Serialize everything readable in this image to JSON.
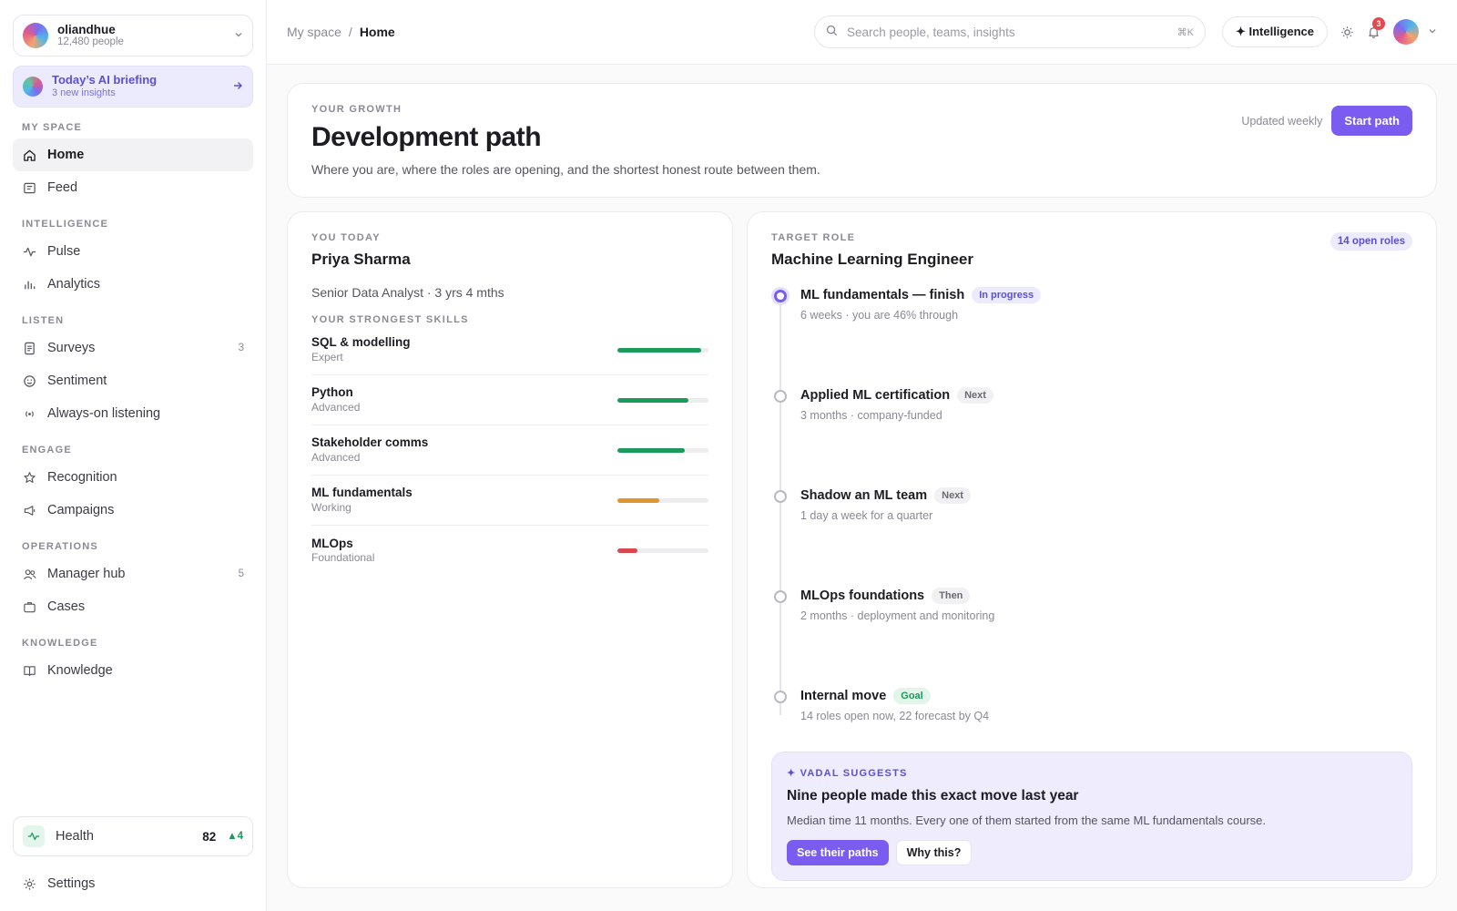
{
  "org": {
    "name": "oliandhue",
    "people": "12,480 people"
  },
  "briefing": {
    "title": "Today’s AI briefing",
    "sub": "3 new insights"
  },
  "sidebar": {
    "sections": {
      "myspace": "MY SPACE",
      "intelligence": "INTELLIGENCE",
      "listen": "LISTEN",
      "engage": "ENGAGE",
      "operations": "OPERATIONS",
      "knowledge": "KNOWLEDGE"
    },
    "items": {
      "home": "Home",
      "feed": "Feed",
      "pulse": "Pulse",
      "analytics": "Analytics",
      "surveys": "Surveys",
      "surveys_count": "3",
      "sentiment": "Sentiment",
      "listening": "Always-on listening",
      "recognition": "Recognition",
      "campaigns": "Campaigns",
      "manager_hub": "Manager hub",
      "manager_hub_count": "5",
      "cases": "Cases",
      "knowledge": "Knowledge"
    },
    "health": {
      "label": "Health",
      "score": "82",
      "delta": "▲4"
    },
    "settings": "Settings"
  },
  "topbar": {
    "crumb_root": "My space",
    "crumb_sep": "/",
    "crumb_current": "Home",
    "search_placeholder": "Search people, teams, insights",
    "search_kbd": "⌘K",
    "intelligence_label": "✦ Intelligence",
    "notifications_count": "3"
  },
  "hero": {
    "eyebrow": "YOUR GROWTH",
    "title": "Development path",
    "subtitle": "Where you are, where the roles are opening, and the shortest honest route between them.",
    "updated": "Updated weekly",
    "start_button": "Start path"
  },
  "you_today": {
    "eyebrow": "YOU TODAY",
    "name": "Priya Sharma",
    "meta": "Senior Data Analyst · 3 yrs 4 mths",
    "skills_label": "YOUR STRONGEST SKILLS",
    "skills": [
      {
        "name": "SQL & modelling",
        "level": "Expert",
        "value": 0.92,
        "color": "#1c9a5c"
      },
      {
        "name": "Python",
        "level": "Advanced",
        "value": 0.78,
        "color": "#1c9a5c"
      },
      {
        "name": "Stakeholder comms",
        "level": "Advanced",
        "value": 0.74,
        "color": "#1c9a5c"
      },
      {
        "name": "ML fundamentals",
        "level": "Working",
        "value": 0.46,
        "color": "#e0952a"
      },
      {
        "name": "MLOps",
        "level": "Foundational",
        "value": 0.22,
        "color": "#d9484f"
      }
    ]
  },
  "target": {
    "eyebrow": "TARGET ROLE",
    "role": "Machine Learning Engineer",
    "open_roles": "14 open roles",
    "steps": [
      {
        "title": "ML fundamentals — finish",
        "tag": "In progress",
        "sub": "6 weeks · you are 46% through"
      },
      {
        "title": "Applied ML certification",
        "tag": "Next",
        "sub": "3 months · company-funded"
      },
      {
        "title": "Shadow an ML team",
        "tag": "Next",
        "sub": "1 day a week for a quarter"
      },
      {
        "title": "MLOps foundations",
        "tag": "Then",
        "sub": "2 months · deployment and monitoring"
      },
      {
        "title": "Internal move",
        "tag": "Goal",
        "sub": "14 roles open now, 22 forecast by Q4"
      }
    ],
    "suggest": {
      "eyebrow": "✦ VADAL SUGGESTS",
      "title": "Nine people made this exact move last year",
      "body": "Median time 11 months. Every one of them started from the same ML fundamentals course.",
      "primary": "See their paths",
      "secondary": "Why this?"
    }
  }
}
